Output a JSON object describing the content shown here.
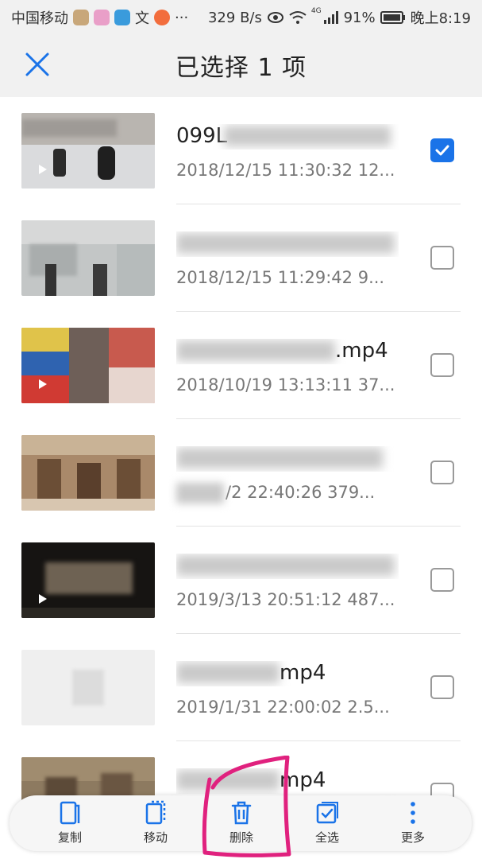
{
  "status_bar": {
    "carrier": "中国移动",
    "more": "···",
    "speed": "329 B/s",
    "network": "4G",
    "battery": "91%",
    "time": "晚上8:19"
  },
  "header": {
    "title": "已选择 1 项"
  },
  "files": [
    {
      "name": "099L",
      "meta": "2018/12/15 11:30:32 12...",
      "checked": true
    },
    {
      "name": "",
      "meta": "2018/12/15 11:29:42 9...",
      "checked": false
    },
    {
      "name": ".mp4",
      "meta": "2018/10/19 13:13:11 37...",
      "checked": false
    },
    {
      "name": "",
      "meta": "/2 22:40:26 379...",
      "checked": false
    },
    {
      "name": "",
      "meta": "2019/3/13 20:51:12 487...",
      "checked": false
    },
    {
      "name": "mp4",
      "meta": "2019/1/31 22:00:02 2.5...",
      "checked": false
    },
    {
      "name": "mp4",
      "meta": "",
      "checked": false
    }
  ],
  "toolbar": {
    "copy": "复制",
    "move": "移动",
    "delete": "删除",
    "select_all": "全选",
    "more": "更多"
  },
  "colors": {
    "accent": "#1a73e8",
    "annotation": "#e0217e"
  }
}
